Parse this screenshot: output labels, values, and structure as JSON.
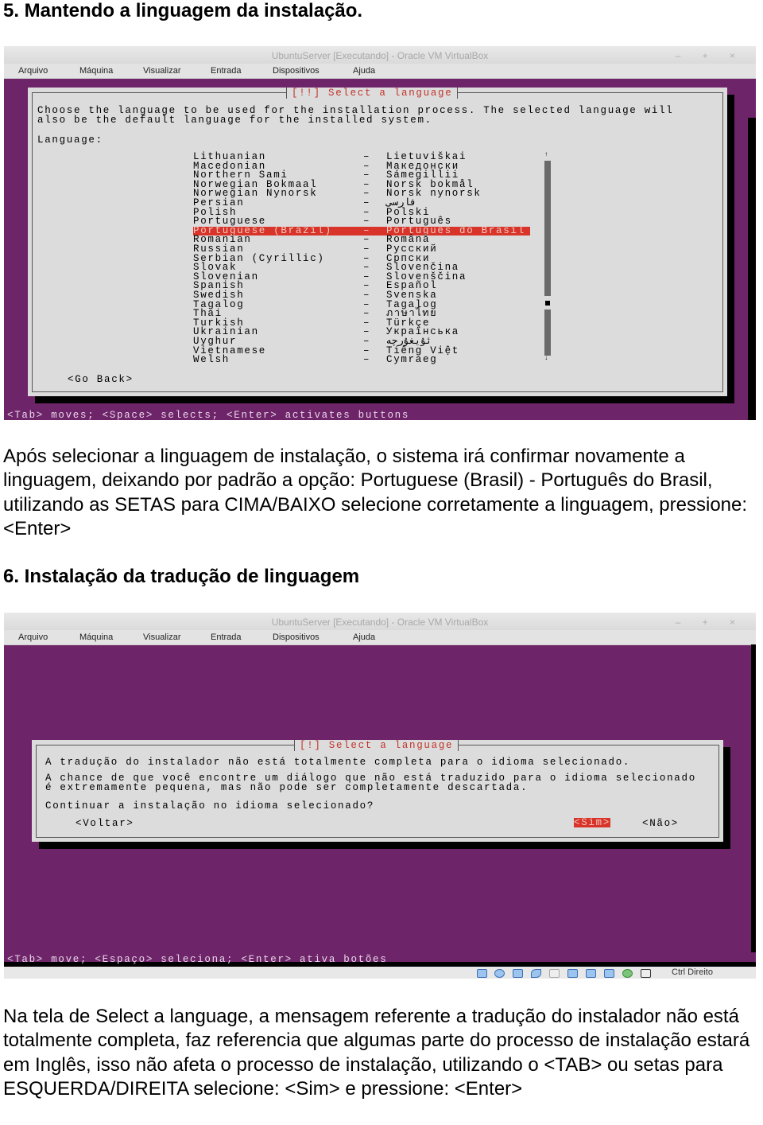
{
  "section5": {
    "heading": "5. Mantendo a linguagem da instalação.",
    "vm": {
      "window_title": "UbuntuServer [Executando] - Oracle VM VirtualBox",
      "window_controls": "– + ×",
      "menu": [
        "Arquivo",
        "Máquina",
        "Visualizar",
        "Entrada",
        "Dispositivos",
        "Ajuda"
      ],
      "dialog_title": "[!!] Select a language",
      "description": "Choose the language to be used for the installation process. The selected language will\nalso be the default language for the installed system.",
      "list_label": "Language:",
      "languages": [
        {
          "en": "Lithuanian",
          "native": "Lietuviškai"
        },
        {
          "en": "Macedonian",
          "native": "Македонски"
        },
        {
          "en": "Northern Sami",
          "native": "Sámegillii"
        },
        {
          "en": "Norwegian Bokmaal",
          "native": "Norsk bokmål"
        },
        {
          "en": "Norwegian Nynorsk",
          "native": "Norsk nynorsk"
        },
        {
          "en": "Persian",
          "native": "فارسی"
        },
        {
          "en": "Polish",
          "native": "Polski"
        },
        {
          "en": "Portuguese",
          "native": "Português"
        },
        {
          "en": "Portuguese (Brazil)",
          "native": "Português do Brasil",
          "selected": true
        },
        {
          "en": "Romanian",
          "native": "Română"
        },
        {
          "en": "Russian",
          "native": "Русский"
        },
        {
          "en": "Serbian (Cyrillic)",
          "native": "Српски"
        },
        {
          "en": "Slovak",
          "native": "Slovenčina"
        },
        {
          "en": "Slovenian",
          "native": "Slovenščina"
        },
        {
          "en": "Spanish",
          "native": "Español"
        },
        {
          "en": "Swedish",
          "native": "Svenska"
        },
        {
          "en": "Tagalog",
          "native": "Tagalog"
        },
        {
          "en": "Thai",
          "native": "ภาษาไทย"
        },
        {
          "en": "Turkish",
          "native": "Türkçe"
        },
        {
          "en": "Ukrainian",
          "native": "Українська"
        },
        {
          "en": "Uyghur",
          "native": "ئۇيغۇرچە"
        },
        {
          "en": "Vietnamese",
          "native": "Tiếng Việt"
        },
        {
          "en": "Welsh",
          "native": "Cymraeg"
        }
      ],
      "separator": "–",
      "go_back": "<Go Back>",
      "status_bar": "<Tab> moves; <Space> selects; <Enter> activates buttons"
    },
    "paragraph": "Após selecionar a linguagem de instalação, o sistema irá confirmar novamente a linguagem, deixando por padrão a opção: Portuguese (Brasil) - Português do Brasil, utilizando as SETAS para CIMA/BAIXO selecione corretamente a linguagem, pressione: <Enter>"
  },
  "section6": {
    "heading": "6. Instalação da tradução de linguagem",
    "vm": {
      "window_title": "UbuntuServer [Executando] - Oracle VM VirtualBox",
      "window_controls": "– + ×",
      "menu": [
        "Arquivo",
        "Máquina",
        "Visualizar",
        "Entrada",
        "Dispositivos",
        "Ajuda"
      ],
      "dialog_title": "[!] Select a language",
      "line1": "A tradução do instalador não está totalmente completa para o idioma selecionado.",
      "line2": "A chance de que você encontre um diálogo que não está traduzido para o idioma selecionado\né extremamente pequena, mas não pode ser completamente descartada.",
      "question": "Continuar a instalação no idioma selecionado?",
      "buttons": {
        "back": "<Voltar>",
        "yes": "<Sim>",
        "no": "<Não>"
      },
      "status_bar": "<Tab> move; <Espaço> seleciona; <Enter> ativa botões",
      "host_key": "Ctrl Direito"
    },
    "paragraph": "Na tela de Select a language, a mensagem referente a tradução do instalador não está totalmente completa, faz referencia que algumas parte do processo de instalação estará em Inglês, isso não afeta o processo de instalação, utilizando o <TAB> ou setas para ESQUERDA/DIREITA selecione: <Sim> e pressione: <Enter>"
  },
  "colors": {
    "vm_purple": "#6e2469",
    "dialog_bg": "#dcdcdc",
    "highlight": "#d8342a",
    "dialog_title": "#c3332a"
  }
}
